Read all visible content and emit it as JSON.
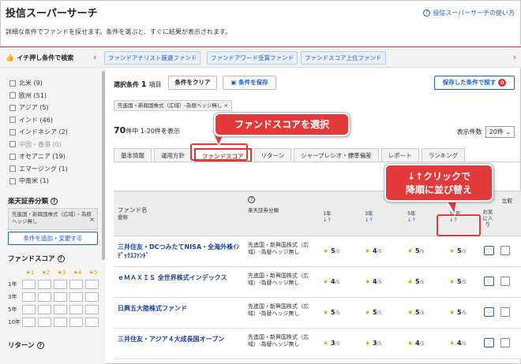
{
  "header": {
    "title": "投信スーパーサーチ",
    "help_link": "投信スーパーサーチの使い方",
    "description": "詳細な条件でファンドを探せます。条件を選ぶと、すぐに結果が表示されます。"
  },
  "recommend": {
    "label": "イチ押し条件で検索",
    "chips": [
      "ファンドアナリスト厳選ファンド",
      "ファンドアワード受賞ファンド",
      "ファンドスコア上位ファンド"
    ]
  },
  "sidebar": {
    "regions": [
      {
        "label": "北米 (9)",
        "dim": false
      },
      {
        "label": "欧州 (51)",
        "dim": false
      },
      {
        "label": "アジア (5)",
        "dim": false
      },
      {
        "label": "インド (46)",
        "dim": false
      },
      {
        "label": "インドネシア (2)",
        "dim": false
      },
      {
        "label": "中国・香港 (0)",
        "dim": true
      },
      {
        "label": "オセアニア (19)",
        "dim": false
      },
      {
        "label": "エマージング (1)",
        "dim": false
      },
      {
        "label": "中南米 (1)",
        "dim": false
      }
    ],
    "category_head": "楽天証券分類",
    "selected_category": "先進国・新興国株式（広域）・為替ヘッジ無し",
    "add_button": "条件を追加・変更する",
    "score_head": "ファンドスコア",
    "score_stars": [
      "★1",
      "★2",
      "★3",
      "★4",
      "★5"
    ],
    "score_periods": [
      "1年",
      "3年",
      "5年",
      "10年"
    ],
    "return_head": "リターン"
  },
  "main": {
    "selected_label": "選択条件",
    "selected_count": "1",
    "selected_unit": "項目",
    "clear_button": "条件をクリア",
    "save_button": "条件を保存",
    "saved_button": "保存した条件で探す",
    "saved_count": "0",
    "condition_tag": "先進国・新興国株式（広域）-為替ヘッジ無し",
    "result_total": "70",
    "result_text": "件中 1-20件を表示",
    "perpage_label": "表示件数",
    "perpage_value": "20件",
    "tabs": [
      "基本情報",
      "運用方針",
      "ファンドスコア",
      "リターン",
      "シャープレシオ・標準偏差",
      "レポート",
      "ランキング"
    ],
    "active_tab": "ファンドスコア",
    "col_fund": "ファンド名",
    "col_fund_sub": "愛称",
    "col_category": "楽天証券分類",
    "col_periods": [
      "1年",
      "3年",
      "5年",
      "10年"
    ],
    "col_sort": "↓↑",
    "col_fav": "お気に入り",
    "col_compare": "比較",
    "rows": [
      {
        "name": "三井住友・DCつみたてNISA・全海外株ｲﾝﾃﾞｯｸｽﾌｧﾝﾄﾞ",
        "category": "先進国・新興国株式（広域）-為替ヘッジ無し",
        "scores": [
          "5",
          "4",
          "5",
          "5"
        ]
      },
      {
        "name": "ｅＭＡＸＩＳ 全世界株式インデックス",
        "category": "先進国・新興国株式（広域）-為替ヘッジ無し",
        "scores": [
          "4",
          "4",
          "5",
          "5"
        ]
      },
      {
        "name": "日興五大陸株式ファンド",
        "category": "先進国・新興国株式（広域）-為替ヘッジ無し",
        "scores": [
          "5",
          "5",
          "5",
          "5"
        ]
      },
      {
        "name": "三井住友・アジア４大成長国オープン",
        "category": "先進国・新興国株式（広域）-為替ヘッジ無し",
        "scores": [
          "3",
          "3",
          "4",
          "4"
        ]
      }
    ],
    "star_suffix": "/5"
  },
  "callouts": {
    "tab": "ファンドスコアを選択",
    "sort": "↓↑クリックで\n降順に並び替え"
  },
  "colors": {
    "accent": "#e23a3a",
    "link": "#1a5ec4",
    "star": "#d9a400"
  }
}
